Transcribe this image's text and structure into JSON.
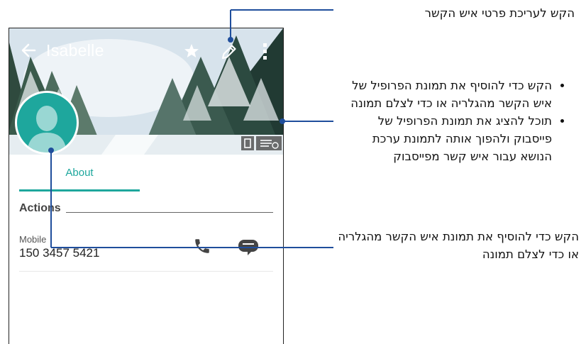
{
  "contact": {
    "name": "Isabelle",
    "tab_about": "About",
    "section_actions": "Actions",
    "mobile_label": "Mobile",
    "mobile_number": "150 3457 5421"
  },
  "icons": {
    "back": "arrow-left-icon",
    "favorite": "star-icon",
    "edit": "pencil-icon",
    "more": "more-vertical-icon",
    "photo": "photo-icon",
    "layout": "layout-list-icon",
    "call": "phone-icon",
    "message": "message-icon"
  },
  "colors": {
    "accent": "#1ea79d",
    "callout_line": "#1f4e9c"
  },
  "callouts": {
    "edit": "הקש לעריכת פרטי איש הקשר",
    "header_items": [
      "הקש כדי להוסיף את תמונת הפרופיל של איש הקשר מהגלריה או כדי לצלם תמונה",
      "תוכל להציג את תמונת הפרופיל של פייסבוק ולהפוך אותה לתמונת ערכת הנושא עבור איש קשר מפייסבוק"
    ],
    "avatar": "הקש כדי להוסיף את תמונת איש הקשר מהגלריה או כדי לצלם תמונה"
  }
}
